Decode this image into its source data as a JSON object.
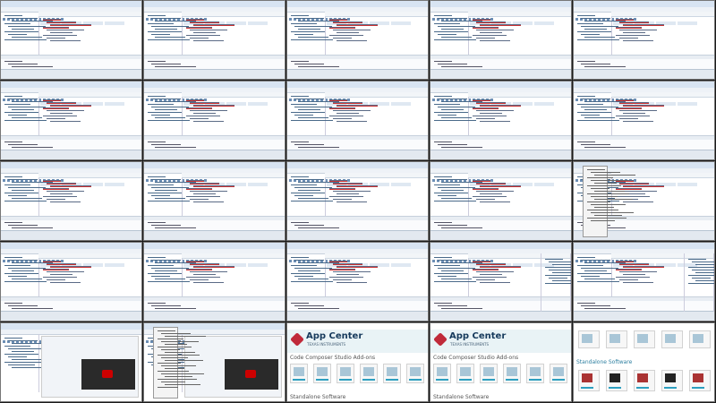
{
  "layout": {
    "rows": 5,
    "cols": 5
  },
  "app_center": {
    "title": "App Center",
    "subtitle": "TEXAS INSTRUMENTS",
    "section_1": "Code Composer Studio Add-ons",
    "section_2": "Standalone Software"
  },
  "tiles": [
    {
      "kind": "ide",
      "name": "ide-screenshot-1"
    },
    {
      "kind": "ide",
      "name": "ide-screenshot-2"
    },
    {
      "kind": "ide",
      "name": "ide-screenshot-3"
    },
    {
      "kind": "ide",
      "name": "ide-screenshot-4"
    },
    {
      "kind": "ide",
      "name": "ide-screenshot-5"
    },
    {
      "kind": "ide",
      "name": "ide-screenshot-6"
    },
    {
      "kind": "ide",
      "name": "ide-screenshot-7"
    },
    {
      "kind": "ide",
      "name": "ide-screenshot-8"
    },
    {
      "kind": "ide",
      "name": "ide-screenshot-9"
    },
    {
      "kind": "ide",
      "name": "ide-screenshot-10"
    },
    {
      "kind": "ide",
      "name": "ide-screenshot-11"
    },
    {
      "kind": "ide",
      "name": "ide-screenshot-12"
    },
    {
      "kind": "ide",
      "name": "ide-screenshot-13"
    },
    {
      "kind": "ide",
      "name": "ide-screenshot-14"
    },
    {
      "kind": "ide-menu",
      "name": "ide-screenshot-15"
    },
    {
      "kind": "ide",
      "name": "ide-screenshot-16"
    },
    {
      "kind": "ide",
      "name": "ide-screenshot-17"
    },
    {
      "kind": "ide",
      "name": "ide-screenshot-18"
    },
    {
      "kind": "ide-split",
      "name": "ide-screenshot-19"
    },
    {
      "kind": "ide-split",
      "name": "ide-screenshot-20"
    },
    {
      "kind": "video",
      "name": "welcome-video-1"
    },
    {
      "kind": "video-menu",
      "name": "welcome-video-2"
    },
    {
      "kind": "app",
      "name": "app-center-1"
    },
    {
      "kind": "app",
      "name": "app-center-2"
    },
    {
      "kind": "app-list",
      "name": "app-center-3"
    }
  ],
  "colors": {
    "accent": "#2d9fc0",
    "banner": "#e9f3f6",
    "brand": "#c02a3a"
  }
}
